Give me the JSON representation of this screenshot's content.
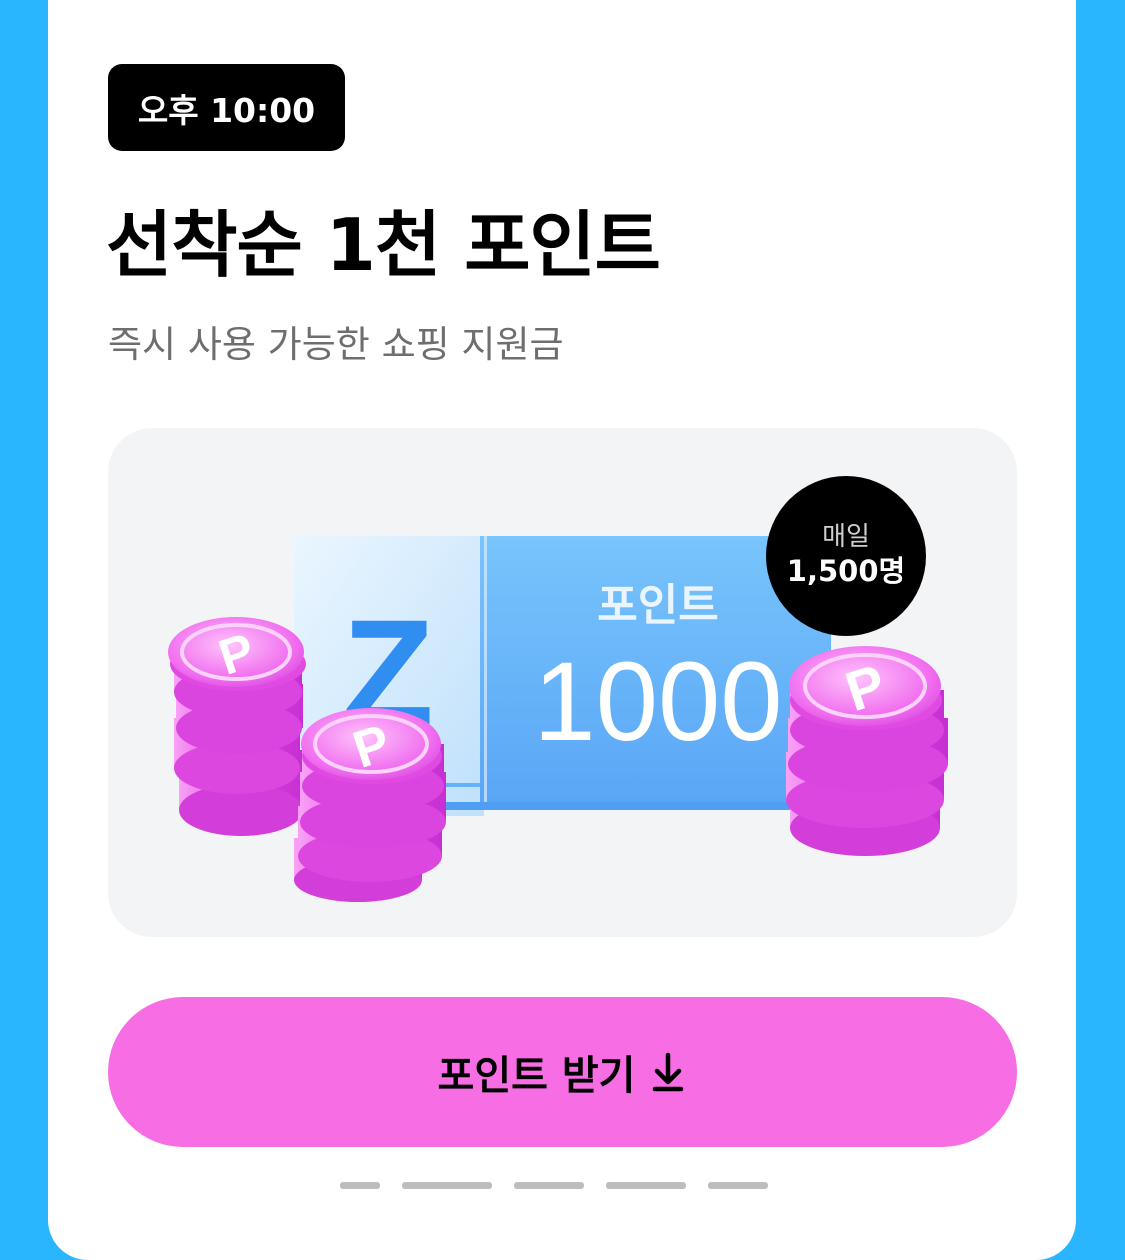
{
  "header": {
    "time_badge": "오후 10:00",
    "headline": "선착순 1천 포인트",
    "subtitle": "즉시 사용 가능한 쇼핑 지원금"
  },
  "hero": {
    "ticket_logo": "Z",
    "ticket_label": "포인트",
    "ticket_amount": "1000",
    "coin_letter": "P",
    "daily_badge": {
      "label": "매일",
      "count": "1,500명"
    }
  },
  "cta": {
    "label": "포인트 받기",
    "icon": "arrow-down-icon"
  },
  "colors": {
    "background": "#29b6ff",
    "card": "#ffffff",
    "cta": "#f76de3",
    "hero_panel": "#f3f4f6",
    "coin": "#e64fe6",
    "ticket": "#5aaaf8",
    "badge": "#000000"
  }
}
